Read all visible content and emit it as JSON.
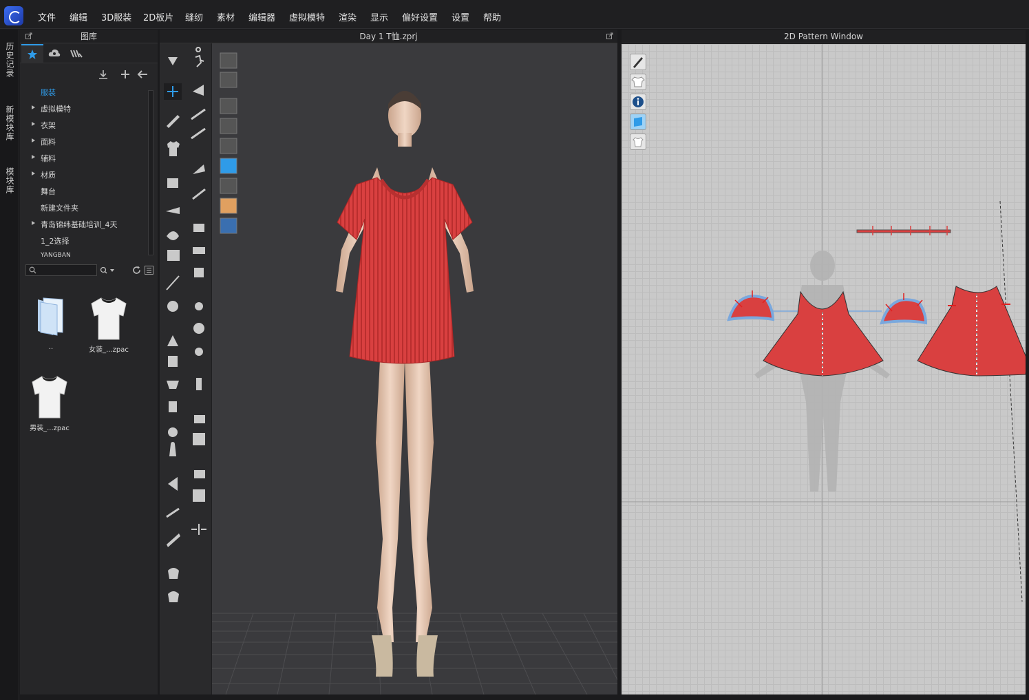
{
  "menubar": {
    "items": [
      "文件",
      "编辑",
      "3D服装",
      "2D板片",
      "缝纫",
      "素材",
      "编辑器",
      "虚拟模特",
      "渲染",
      "显示",
      "偏好设置",
      "设置",
      "帮助"
    ]
  },
  "side_tabs": [
    "历史记录",
    "新模块库",
    "模块库"
  ],
  "library": {
    "title": "图库",
    "tabs": [
      {
        "icon": "star-icon"
      },
      {
        "icon": "cloud-icon"
      },
      {
        "icon": "brand-icon"
      }
    ],
    "tree": [
      {
        "label": "服装",
        "expandable": false,
        "selected": true
      },
      {
        "label": "虚拟模特",
        "expandable": true
      },
      {
        "label": "衣架",
        "expandable": true
      },
      {
        "label": "面料",
        "expandable": true
      },
      {
        "label": "辅料",
        "expandable": true
      },
      {
        "label": "材质",
        "expandable": true
      },
      {
        "label": "舞台",
        "expandable": false
      },
      {
        "label": "新建文件夹",
        "expandable": false
      },
      {
        "label": "青岛锦纬基础培训_4天",
        "expandable": true
      },
      {
        "label": "1_2选择",
        "expandable": false
      },
      {
        "label": "YANGBAN",
        "expandable": false
      }
    ],
    "search_placeholder": "",
    "files": [
      {
        "label": "..",
        "icon": "folder-icon"
      },
      {
        "label": "女装_...zpac",
        "icon": "tshirt-icon"
      },
      {
        "label": "男装_...zpac",
        "icon": "tshirt-icon"
      }
    ]
  },
  "viewport": {
    "title": "Day 1 T恤.zprj"
  },
  "pattern": {
    "title": "2D Pattern Window"
  },
  "colors": {
    "accent": "#2f9be8",
    "garment": "#d94040",
    "seam": "#7aa8dd"
  }
}
